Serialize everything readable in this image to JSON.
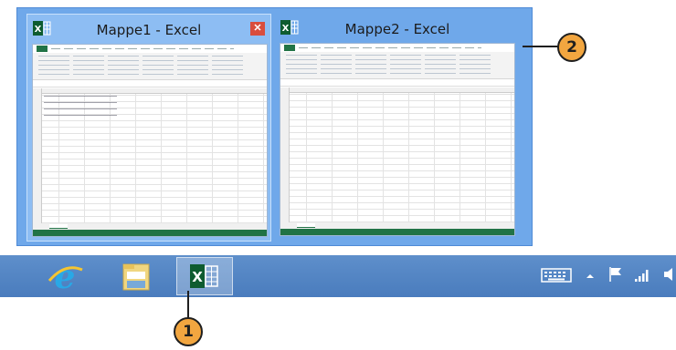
{
  "popup": {
    "thumbnails": [
      {
        "title": "Mappe1 - Excel",
        "close_icon": "close-icon"
      },
      {
        "title": "Mappe2 - Excel"
      }
    ]
  },
  "callouts": {
    "one": "1",
    "two": "2"
  },
  "taskbar": {
    "apps": [
      "internet-explorer-icon",
      "file-explorer-icon",
      "excel-icon"
    ],
    "tray": [
      "keyboard-icon",
      "show-hidden-icons-icon",
      "action-center-flag-icon",
      "network-signal-icon",
      "volume-icon"
    ]
  },
  "colors": {
    "excel_green": "#217346",
    "callout_orange": "#f2a640",
    "popup_blue": "#6fa8ea",
    "taskbar_blue": "#4a7cbd",
    "close_red": "#d94d3d"
  }
}
